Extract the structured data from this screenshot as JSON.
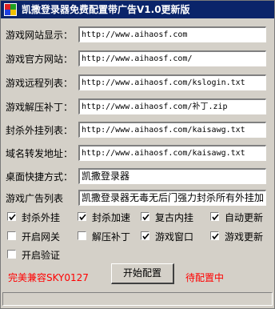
{
  "window": {
    "title": "凯撒登录器免费配置带广告V1.0更新版"
  },
  "fields": [
    {
      "label": "游戏网站显示：",
      "value": "http://www.aihaosf.com"
    },
    {
      "label": "游戏官方网站：",
      "value": "http://www.aihaosf.com/"
    },
    {
      "label": "游戏远程列表：",
      "value": "http://www.aihaosf.com/kslogin.txt"
    },
    {
      "label": "游戏解压补丁：",
      "value": "http://www.aihaosf.com/补丁.zip"
    },
    {
      "label": "封杀外挂列表：",
      "value": "http://www.aihaosf.com/kaisawg.txt"
    },
    {
      "label": "域名转发地址：",
      "value": "http://www.aihaosf.com/kaisawg.txt"
    },
    {
      "label": "桌面快捷方式：",
      "value": "凯撒登录器"
    },
    {
      "label": "游戏广告列表",
      "value": "凯撒登录器无毒无后门强力封杀所有外挂加"
    }
  ],
  "checkboxes": [
    {
      "label": "封杀外挂",
      "checked": true
    },
    {
      "label": "封杀加速",
      "checked": true
    },
    {
      "label": "复古内挂",
      "checked": true
    },
    {
      "label": "自动更新",
      "checked": true
    },
    {
      "label": "开启网关",
      "checked": false
    },
    {
      "label": "解压补丁",
      "checked": false
    },
    {
      "label": "游戏窗口",
      "checked": true
    },
    {
      "label": "游戏更新",
      "checked": true
    },
    {
      "label": "开启验证",
      "checked": false
    }
  ],
  "footer": {
    "compat_text": "完美兼容SKY0127",
    "start_button": "开始配置",
    "status_text": "待配置中"
  },
  "colors": {
    "title_bg": "#0a246a",
    "window_bg": "#d4d0c8",
    "status_red": "#ff0000"
  }
}
